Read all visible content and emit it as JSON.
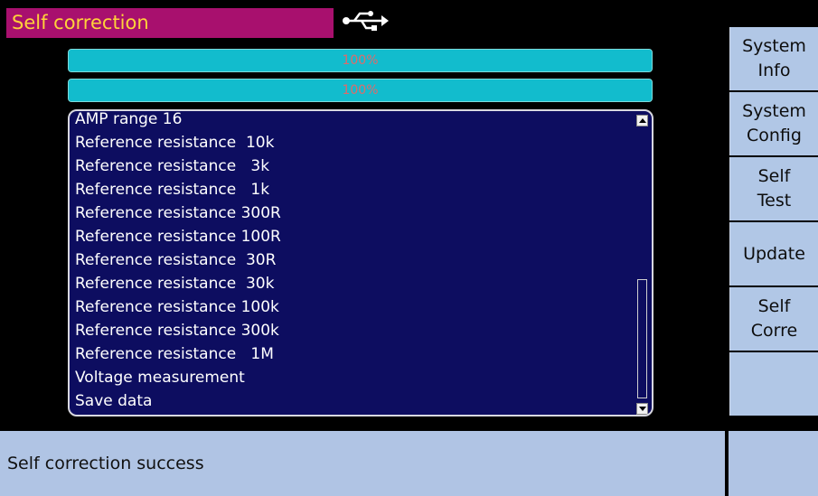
{
  "window": {
    "title": "Self correction",
    "usb_icon": "usb-icon"
  },
  "progress": [
    {
      "value": 1.0,
      "label": "100%"
    },
    {
      "value": 1.0,
      "label": "100%"
    }
  ],
  "log": {
    "items": [
      "AMP range 16",
      "Reference resistance  10k",
      "Reference resistance   3k",
      "Reference resistance   1k",
      "Reference resistance 300R",
      "Reference resistance 100R",
      "Reference resistance  30R",
      "Reference resistance  30k",
      "Reference resistance 100k",
      "Reference resistance 300k",
      "Reference resistance   1M",
      "Voltage measurement",
      "Save data"
    ]
  },
  "menu": {
    "buttons": [
      {
        "id": "system-info",
        "label": "System\nInfo"
      },
      {
        "id": "system-config",
        "label": "System\nConfig"
      },
      {
        "id": "self-test",
        "label": "Self\nTest"
      },
      {
        "id": "update",
        "label": "Update"
      },
      {
        "id": "self-corre",
        "label": "Self\nCorre"
      },
      {
        "id": "empty",
        "label": ""
      }
    ]
  },
  "status": {
    "message": "Self correction success"
  },
  "colors": {
    "title_bg": "#a8106e",
    "title_text": "#ffd23a",
    "progress": "#12bccd",
    "panel": "#0d0d60",
    "button": "#b1c7e6"
  }
}
